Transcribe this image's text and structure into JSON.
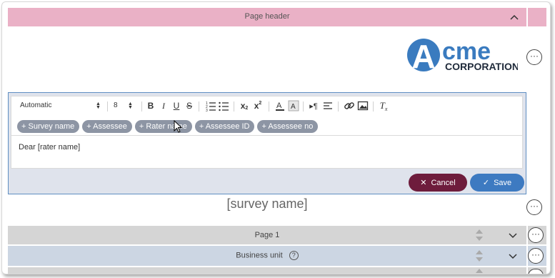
{
  "header": {
    "title": "Page header"
  },
  "logo": {
    "brand_a": "A",
    "brand_cme": "cme",
    "brand_sub": "CORPORATION"
  },
  "editor": {
    "font_select": "Automatic",
    "size_select": "8",
    "tags": [
      "Survey name",
      "Assessee",
      "Rater name",
      "Assessee ID",
      "Assessee no"
    ],
    "body_text": "Dear [rater name]",
    "cancel_label": "Cancel",
    "save_label": "Save"
  },
  "survey_title": "[survey name]",
  "rows": [
    {
      "label": "Page 1"
    },
    {
      "label": "Business unit"
    }
  ],
  "colors": {
    "header_bg": "#eab1c6",
    "cancel": "#6e1c3c",
    "save": "#3d7ac1",
    "tag": "#8d95a4",
    "logo_blue": "#3a7bbf"
  },
  "icons": [
    "chevron-up-icon",
    "more-icon",
    "bold-icon",
    "italic-icon",
    "underline-icon",
    "strikethrough-icon",
    "ordered-list-icon",
    "bullet-list-icon",
    "subscript-icon",
    "superscript-icon",
    "font-color-icon",
    "highlight-icon",
    "ltr-icon",
    "align-icon",
    "link-icon",
    "image-icon",
    "clear-format-icon",
    "close-icon",
    "check-icon",
    "drag-updown-icon",
    "chevron-down-icon",
    "help-icon"
  ]
}
